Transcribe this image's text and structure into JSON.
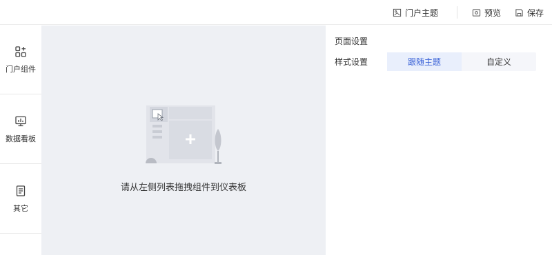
{
  "toolbar": {
    "portal_theme": "门户主题",
    "preview": "预览",
    "save": "保存"
  },
  "sidebar": {
    "items": [
      {
        "label": "门户组件",
        "icon": "widgets-icon"
      },
      {
        "label": "数据看板",
        "icon": "dashboard-chart-icon"
      },
      {
        "label": "其它",
        "icon": "document-icon"
      }
    ]
  },
  "canvas": {
    "empty_text": "请从左侧列表拖拽组件到仪表板"
  },
  "settings": {
    "title": "页面设置",
    "style_label": "样式设置",
    "options": [
      "跟随主题",
      "自定义"
    ],
    "selected": "跟随主题"
  },
  "colors": {
    "accent": "#3a62d7",
    "canvas_bg": "#eef0f4",
    "active_option_bg": "#e9effc"
  }
}
